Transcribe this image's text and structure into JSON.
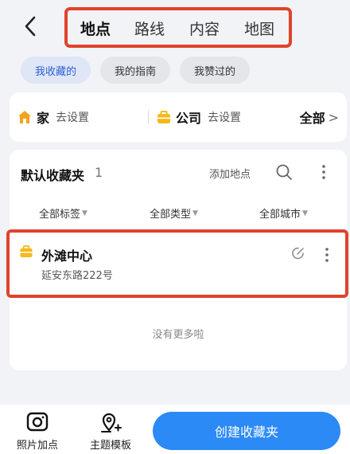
{
  "header": {
    "tabs": [
      {
        "label": "地点",
        "active": true
      },
      {
        "label": "路线",
        "active": false
      },
      {
        "label": "内容",
        "active": false
      },
      {
        "label": "地图",
        "active": false
      }
    ],
    "highlight_color": "#e0432b"
  },
  "pills": [
    {
      "label": "我收藏的",
      "active": true
    },
    {
      "label": "我的指南",
      "active": false
    },
    {
      "label": "我赞过的",
      "active": false
    }
  ],
  "shortcuts": {
    "home": {
      "title": "家",
      "action": "去设置",
      "icon": "home-icon"
    },
    "company": {
      "title": "公司",
      "action": "去设置",
      "icon": "briefcase-icon"
    },
    "all_label": "全部",
    "all_chevron": ">"
  },
  "folder": {
    "title": "默认收藏夹",
    "count": "1",
    "add_place": "添加地点",
    "filters": [
      {
        "label": "全部标签"
      },
      {
        "label": "全部类型"
      },
      {
        "label": "全部城市"
      }
    ],
    "items": [
      {
        "name": "外滩中心",
        "address": "延安东路222号",
        "icon": "briefcase-icon"
      }
    ],
    "no_more": "没有更多啦"
  },
  "bottom": {
    "photo_label": "照片加点",
    "template_label": "主题模板",
    "create_label": "创建收藏夹"
  },
  "colors": {
    "accent_blue": "#2b8af6",
    "pill_active_text": "#2c5fd6",
    "briefcase_yellow": "#f6b81c",
    "home_orange": "#f2a21b"
  }
}
